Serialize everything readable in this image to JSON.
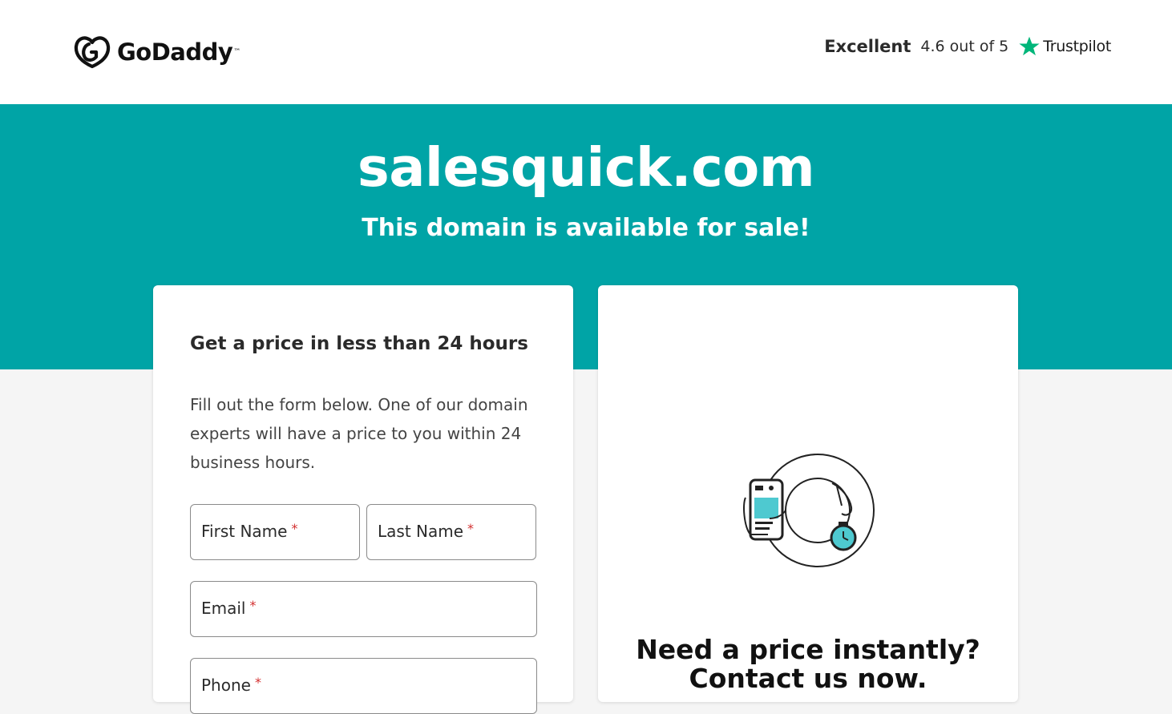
{
  "header": {
    "logo_text": "GoDaddy",
    "logo_tm": "™",
    "trust_rating": "Excellent",
    "trust_score": "4.6 out of 5",
    "trust_brand": "Trustpilot"
  },
  "hero": {
    "domain": "salesquick.com",
    "subtitle": "This domain is available for sale!"
  },
  "form": {
    "title": "Get a price in less than 24 hours",
    "description": "Fill out the form below. One of our domain experts will have a price to you within 24 business hours.",
    "first_name_label": "First Name",
    "last_name_label": "Last Name",
    "email_label": "Email",
    "phone_label": "Phone",
    "required_mark": "*"
  },
  "instant": {
    "title_line1": "Need a price instantly?",
    "title_line2": "Contact us now."
  },
  "colors": {
    "brand_teal": "#00a4a6",
    "trustpilot_green": "#00b67a",
    "required_red": "#d32f2f"
  },
  "icons": [
    "godaddy-logo-icon",
    "trustpilot-star-icon",
    "phone-hand-timer-illustration"
  ]
}
